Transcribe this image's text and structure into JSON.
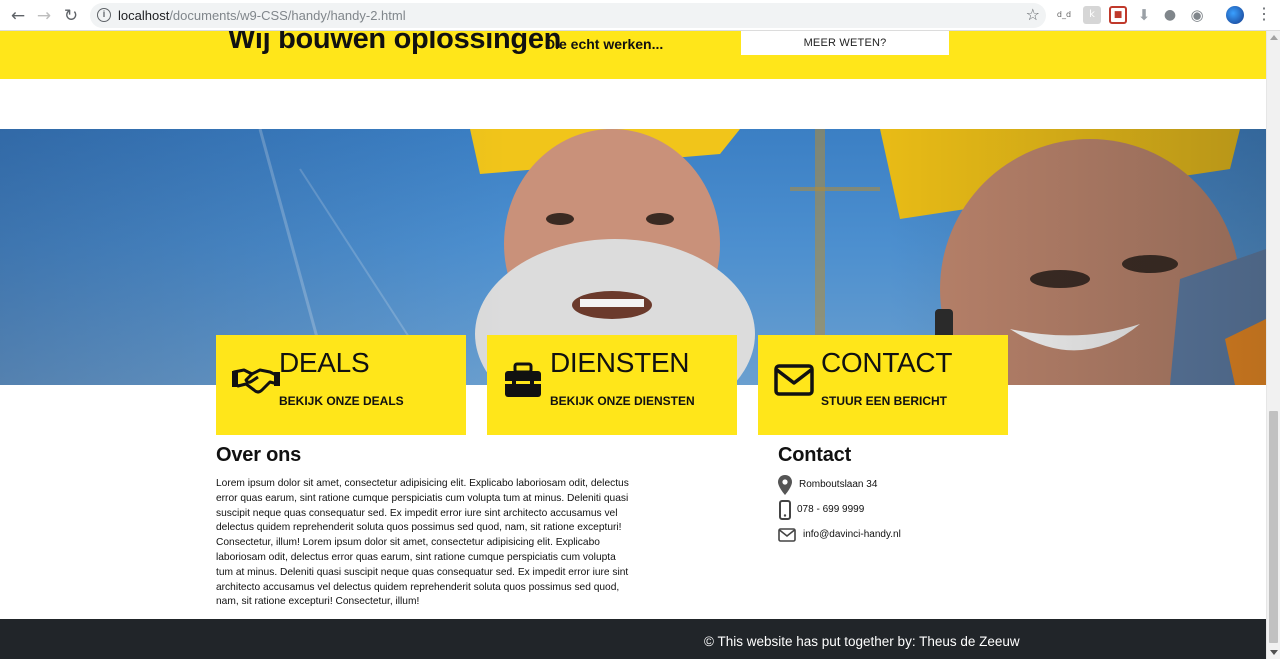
{
  "browser": {
    "url_host": "localhost",
    "url_path": "/documents/w9-CSS/handy/handy-2.html",
    "extensions": [
      "d_d",
      "ext-gray",
      "ext-red",
      "download",
      "lightbulb",
      "chat"
    ]
  },
  "hero": {
    "title": "Wij bouwen oplossingen",
    "subtitle": "Die echt werken...",
    "cta_label": "MEER WETEN?"
  },
  "cards": [
    {
      "title": "DEALS",
      "link": "BEKIJK ONZE DEALS",
      "icon": "handshake-icon"
    },
    {
      "title": "DIENSTEN",
      "link": "BEKIJK ONZE DIENSTEN",
      "icon": "toolbox-icon"
    },
    {
      "title": "CONTACT",
      "link": "STUUR EEN BERICHT",
      "icon": "envelope-icon"
    }
  ],
  "about": {
    "title": "Over ons",
    "text": "Lorem ipsum dolor sit amet, consectetur adipisicing elit. Explicabo laboriosam odit, delectus error quas earum, sint ratione cumque perspiciatis cum volupta tum at minus. Deleniti quasi suscipit neque quas consequatur sed. Ex impedit error iure sint architecto accusamus vel delectus quidem reprehenderit soluta quos possimus sed quod, nam, sit ratione excepturi! Consectetur, illum! Lorem ipsum dolor sit amet, consectetur adipisicing elit. Explicabo laboriosam odit, delectus error quas earum, sint ratione cumque perspiciatis cum volupta tum at minus. Deleniti quasi suscipit neque quas consequatur sed. Ex impedit error iure sint architecto accusamus vel delectus quidem reprehenderit soluta quos possimus sed quod, nam, sit ratione excepturi! Consectetur, illum!"
  },
  "contact": {
    "title": "Contact",
    "address": "Romboutslaan 34",
    "phone": "078 - 699 9999",
    "email": "info@davinci-handy.nl"
  },
  "footer": {
    "text": "© This website has put together by: Theus de Zeeuw"
  },
  "colors": {
    "brand_yellow": "#ffe61a",
    "footer_bg": "#212529"
  }
}
